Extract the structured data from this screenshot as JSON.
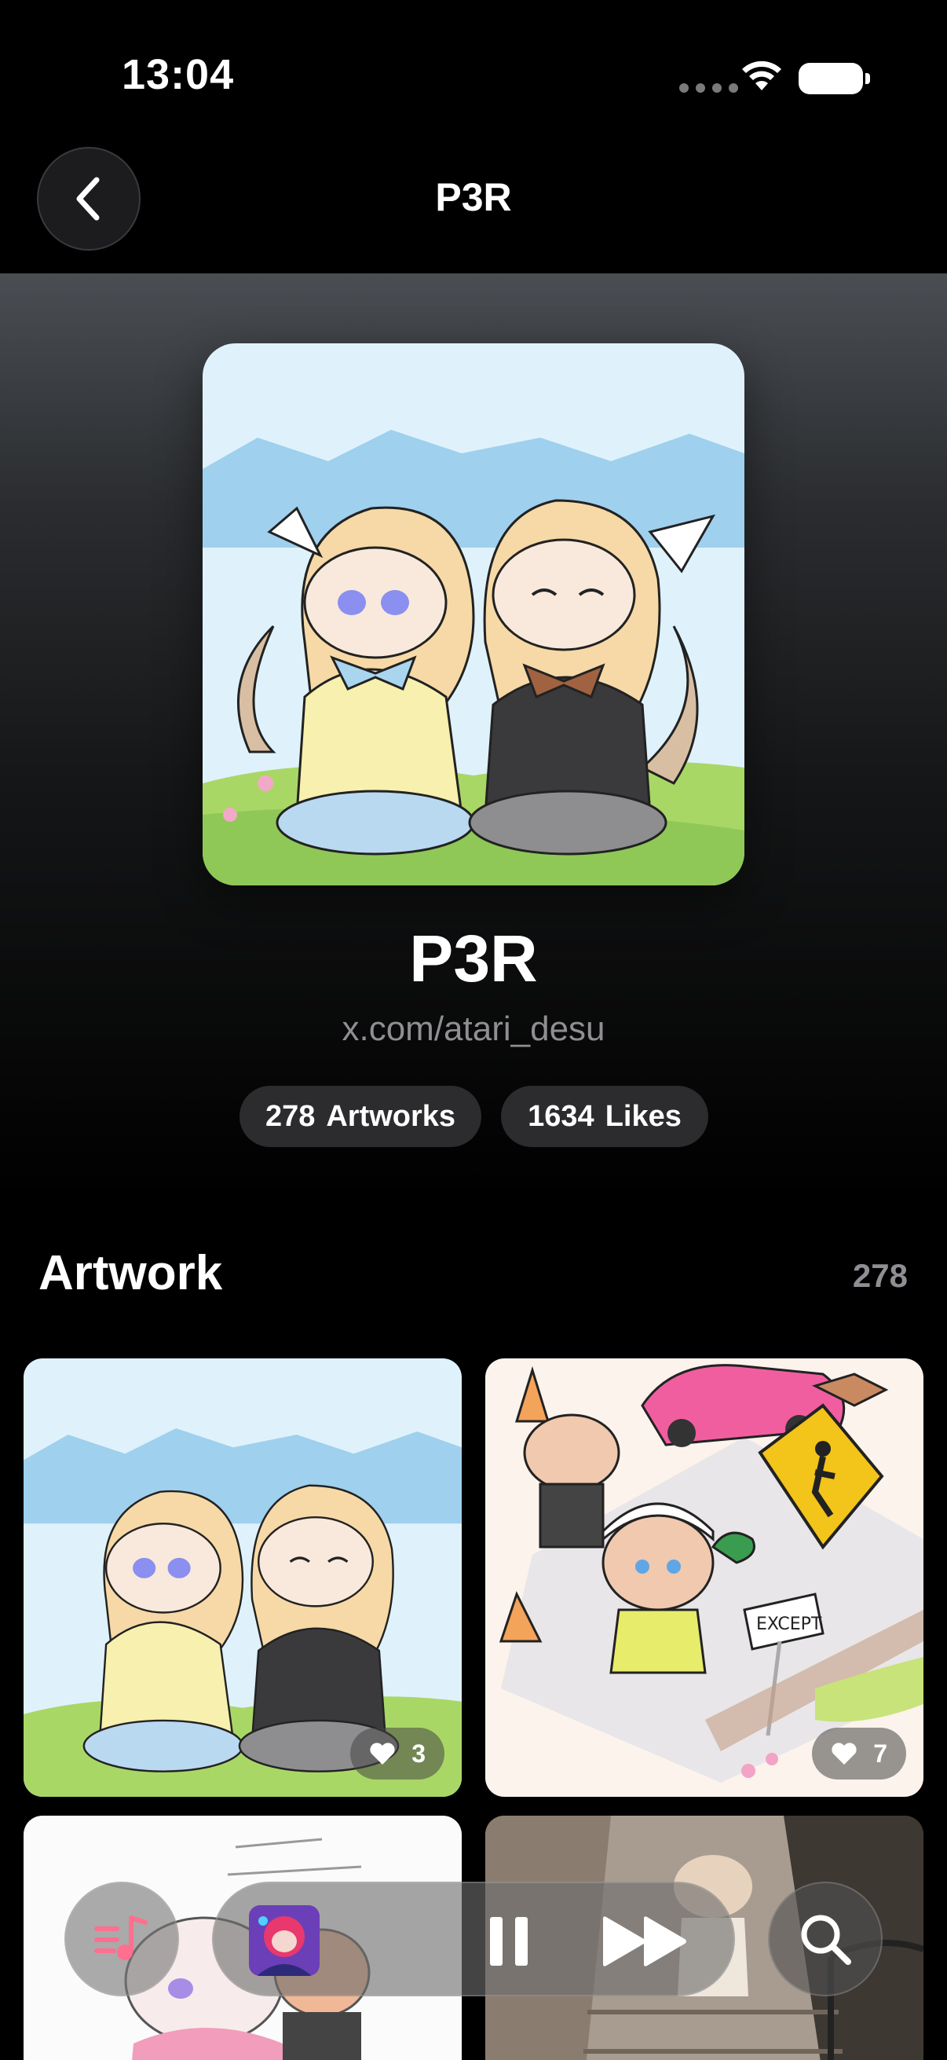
{
  "status_bar": {
    "time": "13:04"
  },
  "nav": {
    "title": "P3R",
    "back_icon": "chevron-left-icon"
  },
  "profile": {
    "name": "P3R",
    "link": "x.com/atari_desu",
    "artworks_count": "278",
    "artworks_label": "Artworks",
    "likes_count": "1634",
    "likes_label": "Likes"
  },
  "section": {
    "title": "Artwork",
    "count": "278"
  },
  "artworks": [
    {
      "likes": "3"
    },
    {
      "likes": "7"
    }
  ],
  "colors": {
    "accent": "#ff5b7f",
    "background": "#000000",
    "pill": "#2c2c2e",
    "secondary_text": "#8e8e93"
  }
}
